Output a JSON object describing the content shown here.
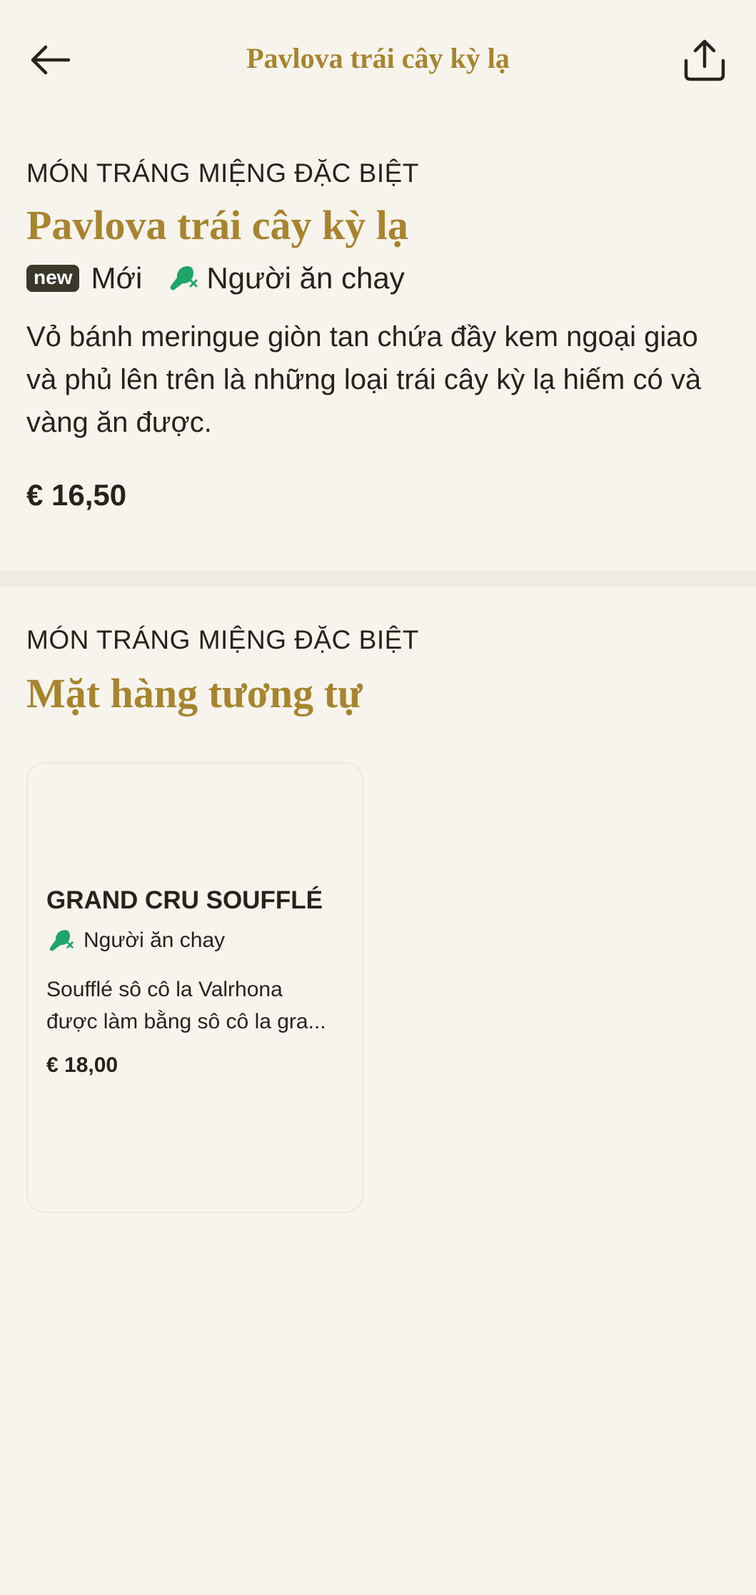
{
  "header": {
    "title": "Pavlova trái cây kỳ lạ",
    "back_icon": "arrow-left-icon",
    "share_icon": "share-icon"
  },
  "item": {
    "category": "MÓN TRÁNG MIỆNG ĐẶC BIỆT",
    "name": "Pavlova trái cây kỳ lạ",
    "badge_new": "new",
    "badge_new_label": "Mới",
    "diet_label": "Người ăn chay",
    "diet_icon": "vegetarian-icon",
    "description": "Vỏ bánh meringue giòn tan chứa đầy kem ngoại giao và phủ lên trên là những loại trái cây kỳ lạ hiếm có và vàng ăn được.",
    "price": "€ 16,50"
  },
  "similar": {
    "category": "MÓN TRÁNG MIỆNG ĐẶC BIỆT",
    "heading": "Mặt hàng tương tự",
    "cards": [
      {
        "name": "GRAND CRU SOUFFLÉ",
        "diet_label": "Người ăn chay",
        "description_line1": "Soufflé sô cô la Valrhona",
        "description_line2": "được làm bằng sô cô la gra...",
        "price": "€ 18,00"
      }
    ]
  },
  "colors": {
    "background": "#f7f4ee",
    "accent_gold": "#a8842f",
    "text": "#26231b",
    "veg_green": "#1fa46a",
    "badge_dark": "#3a372b"
  }
}
